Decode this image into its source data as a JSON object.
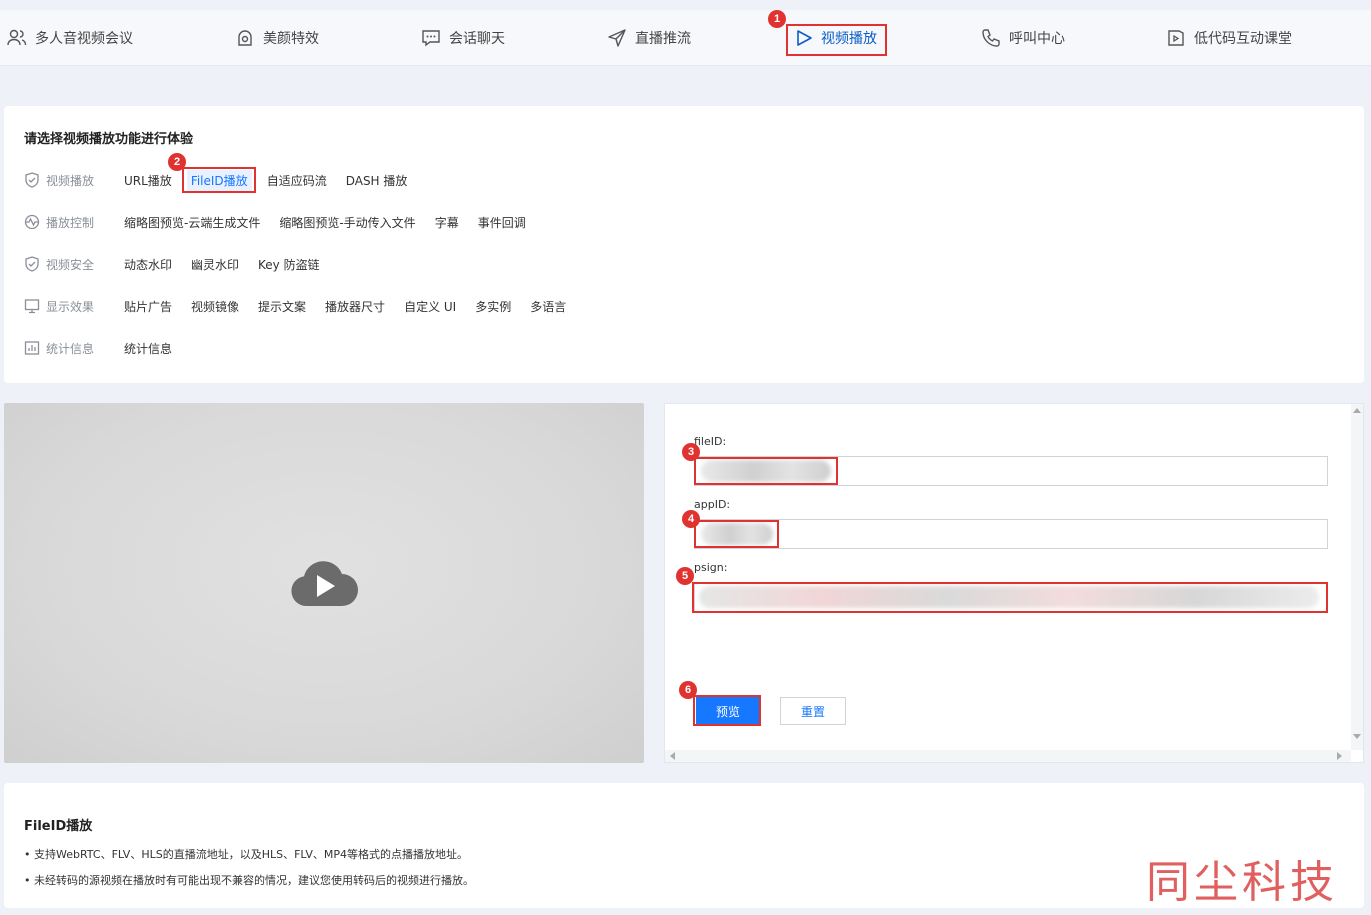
{
  "top_nav": {
    "items": [
      {
        "label": "多人音视频会议",
        "icon": "users-icon"
      },
      {
        "label": "美颜特效",
        "icon": "beauty-icon"
      },
      {
        "label": "会话聊天",
        "icon": "chat-icon"
      },
      {
        "label": "直播推流",
        "icon": "send-icon"
      },
      {
        "label": "视频播放",
        "icon": "play-icon",
        "active": true
      },
      {
        "label": "呼叫中心",
        "icon": "phone-icon"
      },
      {
        "label": "低代码互动课堂",
        "icon": "book-icon"
      }
    ]
  },
  "feature_panel": {
    "title": "请选择视频播放功能进行体验",
    "rows": [
      {
        "label": "视频播放",
        "icon": "shield-check-icon",
        "items": [
          "URL播放",
          "FileID播放",
          "自适应码流",
          "DASH 播放"
        ]
      },
      {
        "label": "播放控制",
        "icon": "pulse-icon",
        "items": [
          "缩略图预览-云端生成文件",
          "缩略图预览-手动传入文件",
          "字幕",
          "事件回调"
        ]
      },
      {
        "label": "视频安全",
        "icon": "shield-check-icon",
        "items": [
          "动态水印",
          "幽灵水印",
          "Key 防盗链"
        ]
      },
      {
        "label": "显示效果",
        "icon": "monitor-icon",
        "items": [
          "贴片广告",
          "视频镜像",
          "提示文案",
          "播放器尺寸",
          "自定义 UI",
          "多实例",
          "多语言"
        ]
      },
      {
        "label": "统计信息",
        "icon": "bar-chart-icon",
        "items": [
          "统计信息"
        ]
      }
    ]
  },
  "form": {
    "fileid_label": "fileID:",
    "appid_label": "appID:",
    "psign_label": "psign:",
    "preview_button": "预览",
    "reset_button": "重置"
  },
  "annotations": [
    "1",
    "2",
    "3",
    "4",
    "5",
    "6"
  ],
  "info": {
    "title": "FileID播放",
    "lines": [
      "• 支持WebRTC、FLV、HLS的直播流地址，以及HLS、FLV、MP4等格式的点播播放地址。",
      "• 未经转码的源视频在播放时有可能出现不兼容的情况，建议您使用转码后的视频进行播放。"
    ]
  },
  "watermark": "同尘科技",
  "colors": {
    "accent": "#1677ff",
    "annotation": "#e0322f"
  }
}
